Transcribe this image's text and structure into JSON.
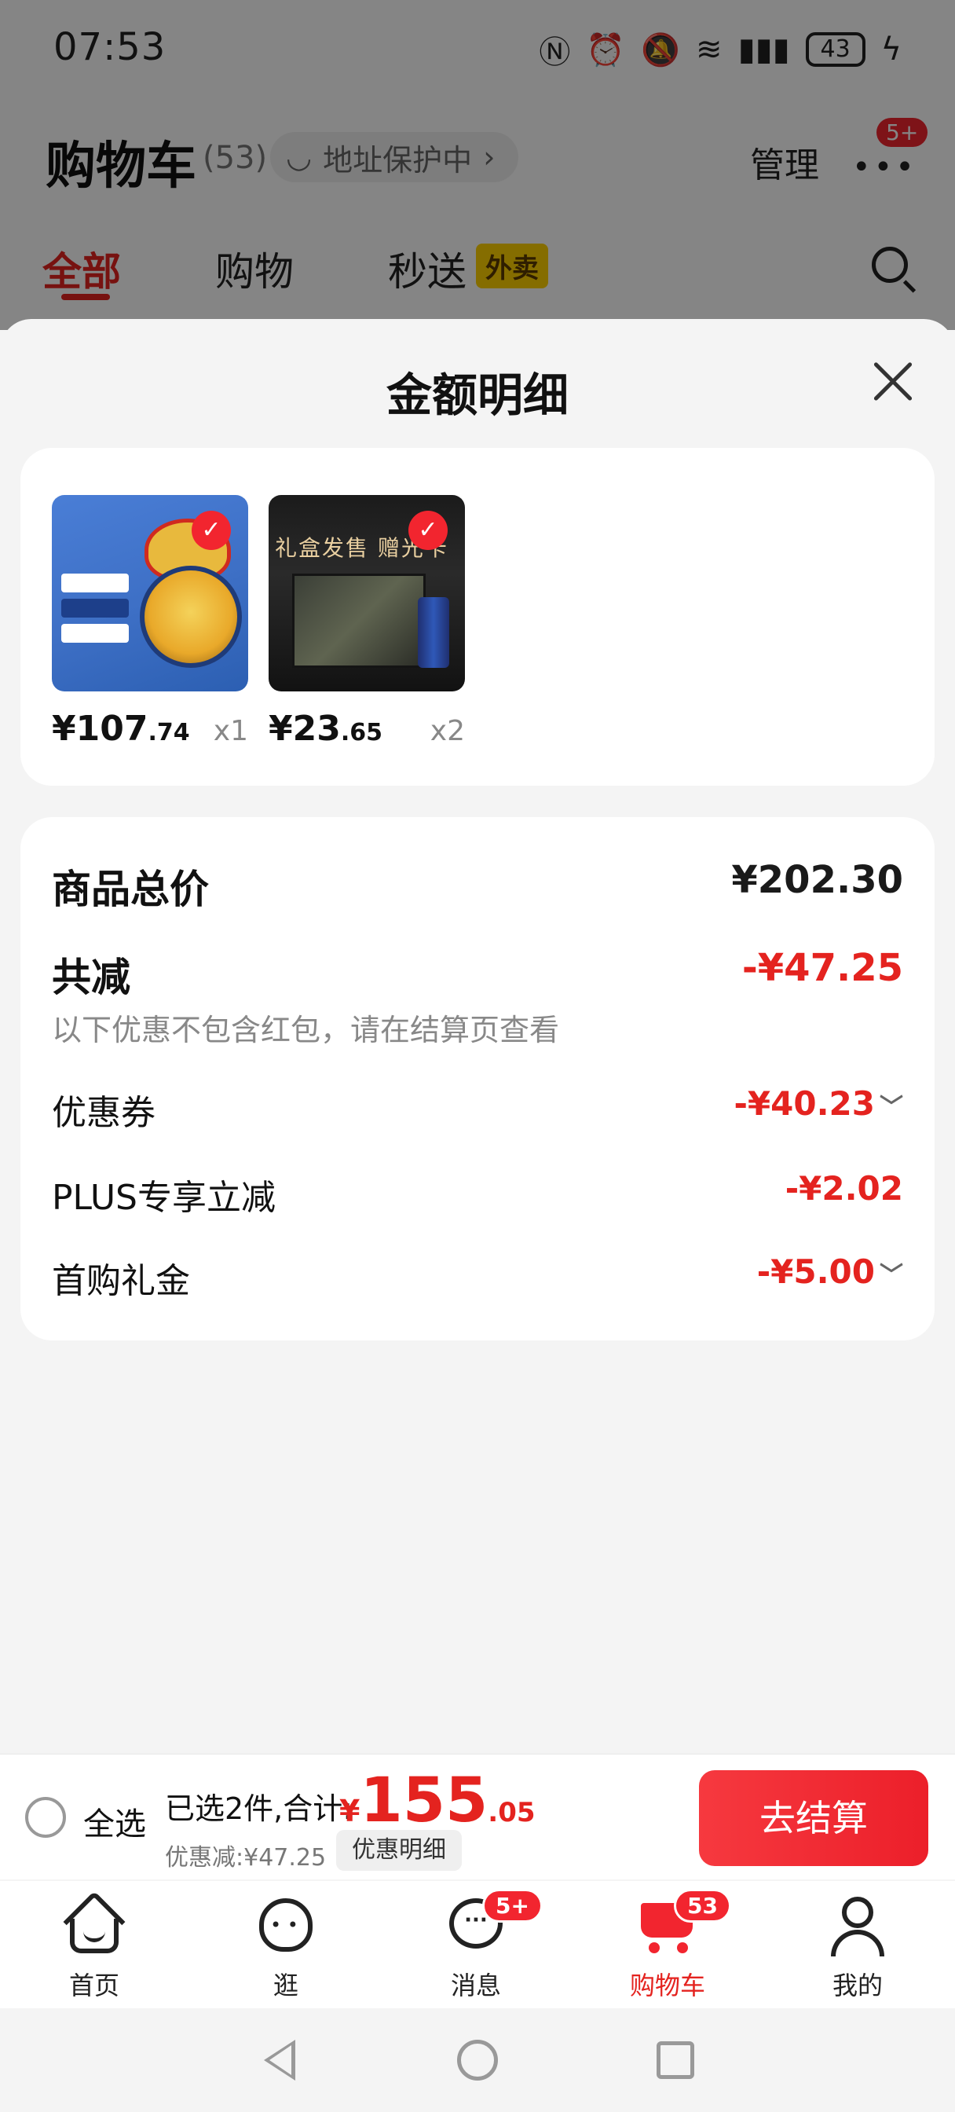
{
  "status_bar": {
    "time": "07:53",
    "battery": "43",
    "icons": [
      "nfc-icon",
      "alarm-icon",
      "mute-icon",
      "wifi-icon",
      "signal-icon",
      "battery-icon",
      "charging-icon"
    ]
  },
  "header": {
    "title": "购物车",
    "count": "(53)",
    "address_protection": "地址保护中",
    "manage": "管理",
    "more_badge": "5+"
  },
  "top_tabs": {
    "all": "全部",
    "shopping": "购物",
    "instant": "秒送",
    "takeout_badge": "外卖"
  },
  "sheet": {
    "title": "金额明细",
    "products": [
      {
        "price_int": "¥107",
        "price_dec": ".74",
        "qty": "x1",
        "selected": true
      },
      {
        "price_int": "¥23",
        "price_dec": ".65",
        "qty": "x2",
        "selected": true,
        "thumb_text": "礼盒发售 赠光卡"
      }
    ],
    "summary": {
      "subtotal_label": "商品总价",
      "subtotal_value": "¥202.30",
      "reduction_label": "共减",
      "reduction_value": "-¥47.25",
      "reduction_note": "以下优惠不包含红包，请在结算页查看",
      "items": [
        {
          "label": "优惠券",
          "value": "-¥40.23",
          "expandable": true
        },
        {
          "label": "PLUS专享立减",
          "value": "-¥2.02",
          "expandable": false
        },
        {
          "label": "首购礼金",
          "value": "-¥5.00",
          "expandable": true
        }
      ]
    }
  },
  "checkout": {
    "select_all": "全选",
    "selected_info": "已选2件,合计:",
    "total_currency": "¥",
    "total_int": "155",
    "total_dec": ".05",
    "discount": "优惠减:¥47.25",
    "detail_button": "优惠明细",
    "checkout_button": "去结算"
  },
  "tabbar": {
    "items": [
      {
        "label": "首页",
        "icon": "home-icon"
      },
      {
        "label": "逛",
        "icon": "browse-icon"
      },
      {
        "label": "消息",
        "icon": "message-icon",
        "badge": "5+"
      },
      {
        "label": "购物车",
        "icon": "cart-icon",
        "badge": "53",
        "active": true
      },
      {
        "label": "我的",
        "icon": "profile-icon"
      }
    ]
  },
  "colors": {
    "accent": "#e4231f",
    "badge": "#f2252f",
    "takeout": "#ffd200"
  }
}
